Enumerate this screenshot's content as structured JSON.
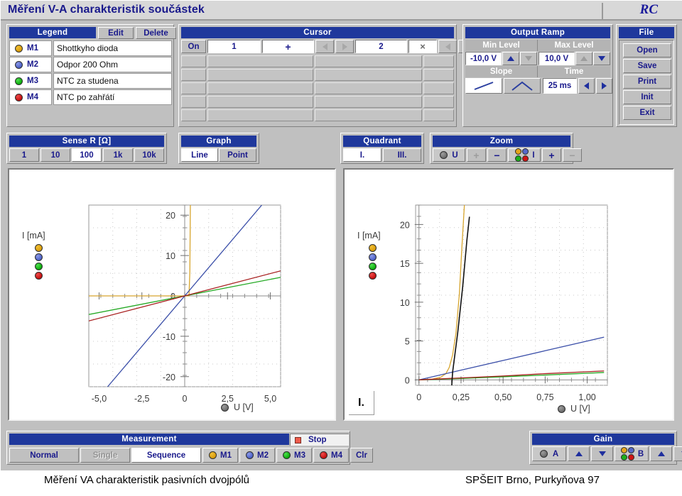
{
  "window": {
    "title": "Měření V-A charakteristik součástek",
    "logo": "RC"
  },
  "legend": {
    "header": "Legend",
    "edit_label": "Edit",
    "delete_label": "Delete",
    "rows": [
      {
        "tag": "M1",
        "name": "Shottkyho dioda",
        "color": "#d79a0a"
      },
      {
        "tag": "M2",
        "name": "Odpor 200 Ohm",
        "color": "#4a5ec4"
      },
      {
        "tag": "M3",
        "name": "NTC za studena",
        "color": "#09a909"
      },
      {
        "tag": "M4",
        "name": "NTC po zahřátí",
        "color": "#c10c0c"
      }
    ]
  },
  "cursor": {
    "header": "Cursor",
    "on_label": "On",
    "c1_label": "1",
    "c1_symbol": "+",
    "c2_label": "2",
    "c2_symbol": "×",
    "rows": 5,
    "cols": 5
  },
  "output_ramp": {
    "header": "Output Ramp",
    "min_level_label": "Min Level",
    "max_level_label": "Max Level",
    "min_level_value": "-10,0 V",
    "max_level_value": "10,0 V",
    "slope_label": "Slope",
    "time_label": "Time",
    "time_value": "25 ms"
  },
  "file": {
    "header": "File",
    "buttons": [
      "Open",
      "Save",
      "Print",
      "Init",
      "Exit"
    ]
  },
  "sense_r": {
    "header": "Sense R  [Ω]",
    "options": [
      "1",
      "10",
      "100",
      "1k",
      "10k"
    ],
    "selected": "100"
  },
  "graph": {
    "header": "Graph",
    "options": [
      "Line",
      "Point"
    ],
    "selected": "Line"
  },
  "quadrant": {
    "header": "Quadrant",
    "options": [
      "I.",
      "III."
    ],
    "selected": "I."
  },
  "zoom": {
    "header": "Zoom",
    "u_label": "U",
    "i_label": "I",
    "u_plus": "+",
    "u_minus": "−",
    "i_plus": "+",
    "i_minus": "−"
  },
  "measurement": {
    "header": "Measurement",
    "status": "Stop",
    "modes": [
      "Normal",
      "Single",
      "Sequence"
    ],
    "selected_mode": "Sequence",
    "disabled_mode": "Single",
    "traces": [
      "M1",
      "M2",
      "M3",
      "M4"
    ],
    "clear_label": "Clr"
  },
  "gain": {
    "header": "Gain",
    "a_label": "A",
    "b_label": "B"
  },
  "caption": {
    "left": "Měření  VA charakteristik pasivních dvojpólů",
    "right": "SPŠEIT Brno, Purkyňova 97"
  },
  "chart_data": [
    {
      "type": "line",
      "title": "",
      "xlabel": "U [V]",
      "ylabel": "I [mA]",
      "xlim": [
        -5.6,
        5.6
      ],
      "ylim": [
        -22.5,
        22.5
      ],
      "xticks": [
        -5.0,
        -2.5,
        0,
        2.5,
        5.0
      ],
      "xticklabels": [
        "-5,0",
        "-2,5",
        "0",
        "2,5",
        "5,0"
      ],
      "yticks": [
        -20,
        -10,
        0,
        10,
        20
      ],
      "yticklabels": [
        "-20",
        "-10",
        "0",
        "10",
        "20"
      ],
      "grid": true,
      "legend": [
        "M1",
        "M2",
        "M3",
        "M4"
      ],
      "series": [
        {
          "name": "M1",
          "label": "Shottkyho dioda",
          "color": "#d7a52e",
          "x": [
            -5.6,
            0.25,
            0.3,
            0.33
          ],
          "y": [
            0,
            0,
            6,
            22.5
          ]
        },
        {
          "name": "M2",
          "label": "Odpor 200 Ohm",
          "color": "#3a4ea8",
          "x": [
            -4.5,
            0,
            4.5
          ],
          "y": [
            -22.5,
            0,
            22.5
          ]
        },
        {
          "name": "M3",
          "label": "NTC za studena",
          "color": "#22a822",
          "x": [
            -5.6,
            0,
            5.6
          ],
          "y": [
            -4.6,
            0,
            4.6
          ]
        },
        {
          "name": "M4",
          "label": "NTC po zahřátí",
          "color": "#a81f1f",
          "x": [
            -5.6,
            0,
            5.6
          ],
          "y": [
            -6.2,
            0,
            6.2
          ]
        }
      ]
    },
    {
      "type": "line",
      "title": "",
      "xlabel": "U [V]",
      "ylabel": "I [mA]",
      "xlim": [
        -0.02,
        1.12
      ],
      "ylim": [
        -0.7,
        22.5
      ],
      "xticks": [
        0,
        0.25,
        0.5,
        0.75,
        1.0
      ],
      "xticklabels": [
        "0",
        "0,25",
        "0,50",
        "0,75",
        "1,00"
      ],
      "yticks": [
        0,
        5,
        10,
        15,
        20
      ],
      "yticklabels": [
        "0",
        "5",
        "10",
        "15",
        "20"
      ],
      "grid": true,
      "legend": [
        "M1",
        "M2",
        "M3",
        "M4"
      ],
      "quadrant_marker": "I.",
      "series": [
        {
          "name": "M1",
          "label": "Shottkyho dioda",
          "color": "#d7a52e",
          "x": [
            0,
            0.08,
            0.13,
            0.16,
            0.18,
            0.2,
            0.22,
            0.24,
            0.255,
            0.27
          ],
          "y": [
            0,
            0.1,
            0.35,
            0.8,
            1.6,
            3.2,
            6.0,
            11.0,
            17.0,
            22.5
          ]
        },
        {
          "name": "M2",
          "label": "Odpor 200 Ohm",
          "color": "#3a4ea8",
          "x": [
            0,
            0.25,
            0.5,
            0.75,
            1.0,
            1.1
          ],
          "y": [
            0,
            1.25,
            2.5,
            3.75,
            5.0,
            5.5
          ]
        },
        {
          "name": "M3",
          "label": "NTC za studena",
          "color": "#22a822",
          "x": [
            0,
            0.25,
            0.5,
            0.75,
            1.0,
            1.1
          ],
          "y": [
            0,
            0.18,
            0.4,
            0.62,
            0.85,
            0.95
          ]
        },
        {
          "name": "M4",
          "label": "NTC po zahřátí",
          "color": "#a81f1f",
          "x": [
            0,
            0.25,
            0.5,
            0.75,
            1.0,
            1.1
          ],
          "y": [
            0,
            0.25,
            0.5,
            0.8,
            1.05,
            1.15
          ]
        },
        {
          "name": "cursor",
          "label": "cursor line",
          "color": "#111111",
          "x": [
            0.195,
            0.2,
            0.23,
            0.26,
            0.285,
            0.3
          ],
          "y": [
            -0.7,
            1.0,
            6.0,
            12.0,
            18.0,
            21.0
          ]
        }
      ]
    }
  ]
}
